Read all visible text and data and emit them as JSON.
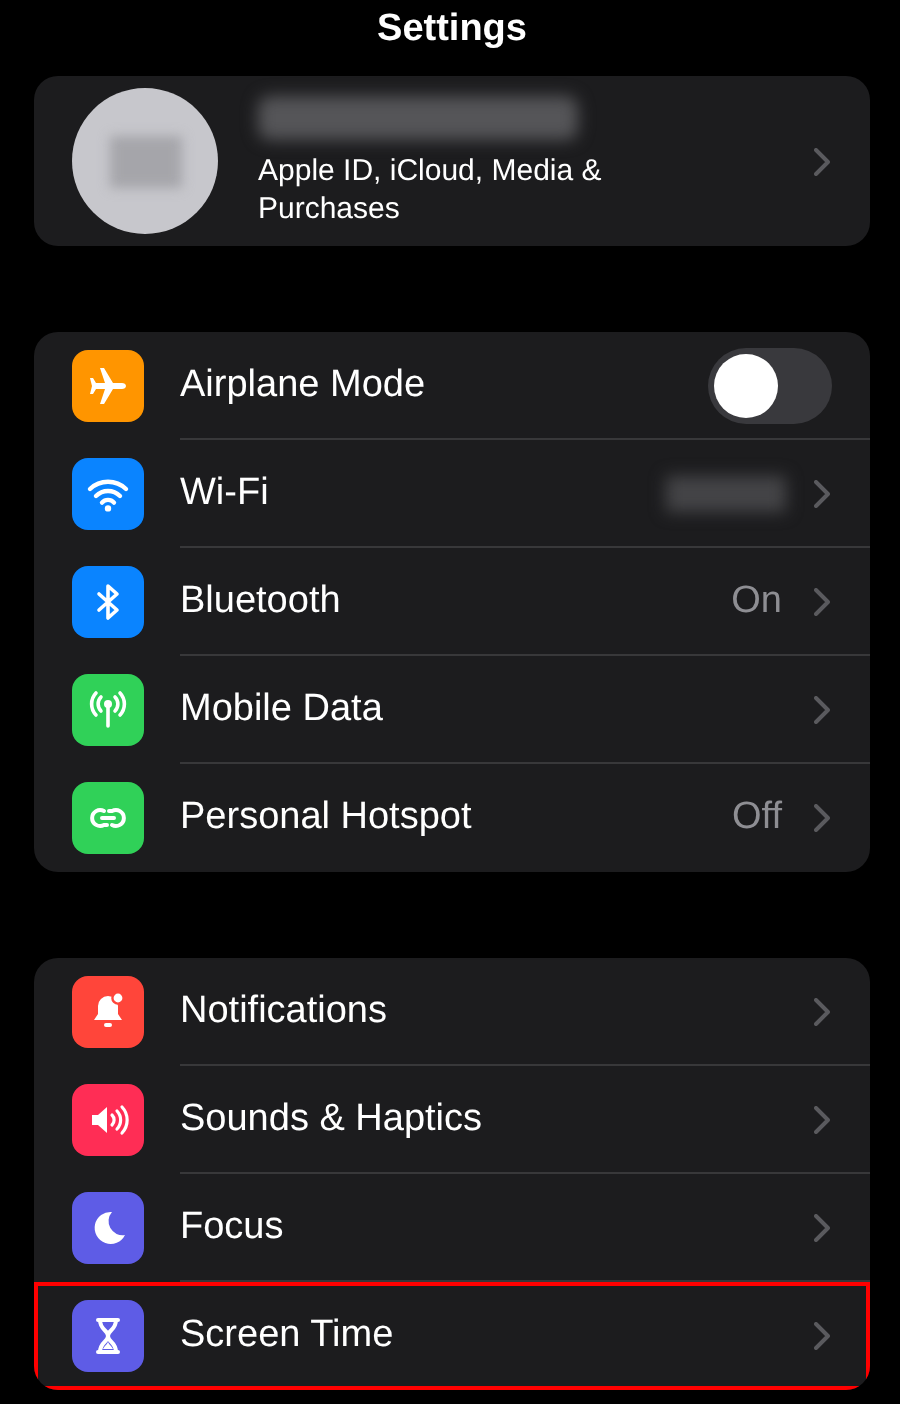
{
  "title": "Settings",
  "profile": {
    "subtitle": "Apple ID, iCloud, Media & Purchases"
  },
  "groups": [
    {
      "items": [
        {
          "kind": "toggle",
          "color": "#ff9500",
          "label": "Airplane Mode",
          "on": false
        },
        {
          "kind": "link",
          "color": "#0a84ff",
          "label": "Wi-Fi",
          "detail_blurred": true
        },
        {
          "kind": "link",
          "color": "#0a84ff",
          "label": "Bluetooth",
          "detail": "On"
        },
        {
          "kind": "link",
          "color": "#30d158",
          "label": "Mobile Data"
        },
        {
          "kind": "link",
          "color": "#30d158",
          "label": "Personal Hotspot",
          "detail": "Off"
        }
      ]
    },
    {
      "items": [
        {
          "kind": "link",
          "color": "#ff453a",
          "label": "Notifications"
        },
        {
          "kind": "link",
          "color": "#ff2d55",
          "label": "Sounds & Haptics"
        },
        {
          "kind": "link",
          "color": "#5e5ce6",
          "label": "Focus"
        },
        {
          "kind": "link",
          "color": "#5e5ce6",
          "label": "Screen Time",
          "highlighted": true
        }
      ]
    }
  ]
}
